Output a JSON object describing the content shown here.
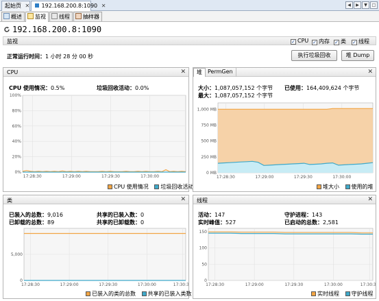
{
  "doc_tabs": {
    "start": "起始页",
    "connection": "192.168.200.8:1090"
  },
  "sub_tabs": {
    "overview": "概述",
    "monitor": "监视",
    "threads": "线程",
    "sampler": "抽样器"
  },
  "title": "192.168.200.8:1090",
  "monitor": {
    "label": "监视",
    "checks": [
      {
        "label": "CPU",
        "checked": true
      },
      {
        "label": "内存",
        "checked": true
      },
      {
        "label": "类",
        "checked": true
      },
      {
        "label": "线程",
        "checked": true
      }
    ],
    "uptime_label": "正常运行时间：",
    "uptime_value": "1 小时 28 分 00 秒",
    "gc_button": "执行垃圾回收",
    "heap_dump_button": "堆 Dump"
  },
  "cpu_panel": {
    "title": "CPU",
    "usage_label": "CPU 使用情况：",
    "usage_value": "0.5%",
    "gc_label": "垃圾回收活动：",
    "gc_value": "0.0%",
    "legend": [
      "CPU 使用情况",
      "垃圾回收活动"
    ]
  },
  "heap_panel": {
    "tabs": [
      "堆",
      "PermGen"
    ],
    "size_label": "大小：",
    "size_value": "1,087,057,152 个字节",
    "max_label": "最大：",
    "max_value": "1,087,057,152 个字节",
    "used_label": "已使用：",
    "used_value": "164,409,624 个字节",
    "legend": [
      "堆大小",
      "使用的堆"
    ]
  },
  "classes_panel": {
    "title": "类",
    "loaded_label": "已装入的总数：",
    "loaded_value": "9,016",
    "unloaded_label": "已卸载的总数：",
    "unloaded_value": "89",
    "shared_loaded_label": "共享的已装入数：",
    "shared_loaded_value": "0",
    "shared_unloaded_label": "共享的已卸载数：",
    "shared_unloaded_value": "0",
    "legend": [
      "已装入的类的总数",
      "共享的已装入类数"
    ]
  },
  "threads_panel": {
    "title": "线程",
    "live_label": "活动：",
    "live_value": "147",
    "peak_label": "实时峰值：",
    "peak_value": "527",
    "daemon_label": "守护进程：",
    "daemon_value": "143",
    "started_label": "已启动的总数：",
    "started_value": "2,581",
    "legend": [
      "实时线程",
      "守护线程"
    ]
  },
  "colors": {
    "orange": "#f2a544",
    "teal": "#3fa9c9",
    "orange_fill": "#f6d2a8",
    "teal_fill": "#c8ecf5"
  },
  "chart_data": [
    {
      "type": "area",
      "title": "CPU",
      "x": [
        "17:28:30",
        "17:29:00",
        "17:29:30",
        "17:30:00"
      ],
      "ylabels": [
        "0%",
        "20%",
        "40%",
        "60%",
        "80%",
        "100%"
      ],
      "ylim": [
        0,
        100
      ],
      "series": [
        {
          "name": "CPU 使用情况",
          "values": [
            1,
            2,
            1,
            0.5,
            1,
            0.5,
            1,
            0.5,
            1,
            0.5,
            1.5,
            0.5,
            1,
            0.5,
            1,
            0.5,
            1,
            0.5,
            0.5,
            0.5,
            1,
            0.5,
            1,
            0.5,
            0.5,
            0.5,
            1,
            0.5,
            0.5,
            1,
            0.5,
            1,
            0.5,
            0.5,
            1,
            0.5,
            3,
            0.5,
            1,
            0.5,
            1,
            0.5
          ]
        },
        {
          "name": "垃圾回收活动",
          "values": [
            0,
            0,
            0,
            0,
            0,
            0,
            0,
            0,
            0,
            0,
            0,
            0,
            0,
            0,
            0,
            0,
            0,
            0,
            0,
            0,
            0,
            0,
            0,
            0,
            0,
            0,
            0,
            0,
            0,
            0,
            0,
            0,
            0,
            0,
            0,
            0,
            0,
            0,
            0,
            0,
            0,
            0
          ]
        }
      ]
    },
    {
      "type": "area",
      "title": "堆",
      "x": [
        "17:28:30",
        "17:29:00",
        "17:29:30",
        "17:30:00"
      ],
      "ylabels": [
        "0 MB",
        "250 MB",
        "500 MB",
        "750 MB",
        "1,000 MB"
      ],
      "ylim": [
        0,
        1100
      ],
      "series": [
        {
          "name": "堆大小",
          "values": [
            1000,
            1000,
            1000,
            1000,
            1000,
            1000,
            1000,
            1000,
            1000,
            1000,
            1000,
            1000,
            1000,
            1000,
            1000,
            1000,
            1000,
            1000,
            1000,
            1000,
            1010,
            1010,
            1010,
            1010,
            1010,
            1010,
            1010,
            1010
          ]
        },
        {
          "name": "使用的堆",
          "values": [
            150,
            155,
            160,
            165,
            170,
            175,
            180,
            165,
            115,
            120,
            125,
            130,
            135,
            140,
            145,
            150,
            130,
            135,
            140,
            150,
            155,
            120,
            125,
            130,
            135,
            140,
            150,
            160
          ]
        }
      ]
    },
    {
      "type": "line",
      "title": "类",
      "x": [
        "17:28:30",
        "17:29:00",
        "17:29:30",
        "17:30:00",
        "17:30:30"
      ],
      "ylabels": [
        "0",
        "5,000"
      ],
      "ylim": [
        0,
        10000
      ],
      "series": [
        {
          "name": "已装入的类的总数",
          "values": [
            9016,
            9016,
            9016,
            9016,
            9016,
            9016,
            9016,
            9016,
            9016,
            9016
          ]
        },
        {
          "name": "共享的已装入类数",
          "values": [
            0,
            0,
            0,
            0,
            0,
            0,
            0,
            0,
            0,
            0
          ]
        }
      ]
    },
    {
      "type": "line",
      "title": "线程",
      "x": [
        "17:28:30",
        "17:29:00",
        "17:29:30",
        "17:30:00",
        "17:30:30"
      ],
      "ylabels": [
        "0",
        "50",
        "100",
        "150"
      ],
      "ylim": [
        0,
        160
      ],
      "series": [
        {
          "name": "实时线程",
          "values": [
            149,
            149,
            149,
            148,
            148,
            148,
            148,
            147,
            147,
            147,
            147,
            147,
            147,
            147,
            146,
            146
          ]
        },
        {
          "name": "守护线程",
          "values": [
            145,
            145,
            145,
            144,
            144,
            144,
            144,
            143,
            143,
            143,
            143,
            143,
            143,
            143,
            142,
            142
          ]
        }
      ]
    }
  ]
}
